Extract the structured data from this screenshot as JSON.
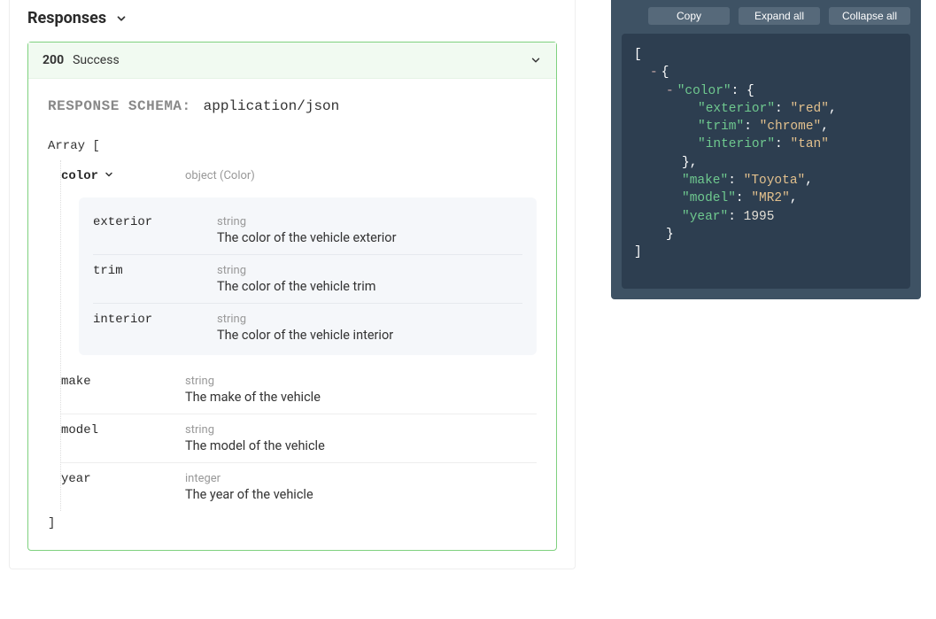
{
  "section_title": "Responses",
  "responses": {
    "status_code": "200",
    "status_text": "Success",
    "schema_label": "RESPONSE SCHEMA:",
    "content_type": "application/json",
    "array_open": "Array [",
    "array_close": "]",
    "root": {
      "color": {
        "name": "color",
        "type_label": "object (Color)",
        "children": {
          "exterior": {
            "name": "exterior",
            "type": "string",
            "description": "The color of the vehicle exterior"
          },
          "trim": {
            "name": "trim",
            "type": "string",
            "description": "The color of the vehicle trim"
          },
          "interior": {
            "name": "interior",
            "type": "string",
            "description": "The color of the vehicle interior"
          }
        }
      },
      "make": {
        "name": "make",
        "type": "string",
        "description": "The make of the vehicle"
      },
      "model": {
        "name": "model",
        "type": "string",
        "description": "The model of the vehicle"
      },
      "year": {
        "name": "year",
        "type": "integer",
        "description": "The year of the vehicle"
      }
    }
  },
  "buttons": {
    "copy": "Copy",
    "expand": "Expand all",
    "collapse": "Collapse all"
  },
  "example_json": {
    "keys": {
      "color": "color",
      "exterior": "exterior",
      "trim": "trim",
      "interior": "interior",
      "make": "make",
      "model": "model",
      "year": "year"
    },
    "values": {
      "exterior": "red",
      "trim": "chrome",
      "interior": "tan",
      "make": "Toyota",
      "model": "MR2",
      "year": "1995"
    }
  },
  "punct": {
    "obr": "[",
    "cbr": "]",
    "ocb": "{",
    "ccb": "}",
    "colon": ":",
    "comma": ",",
    "minus": "-",
    "q": "\""
  }
}
